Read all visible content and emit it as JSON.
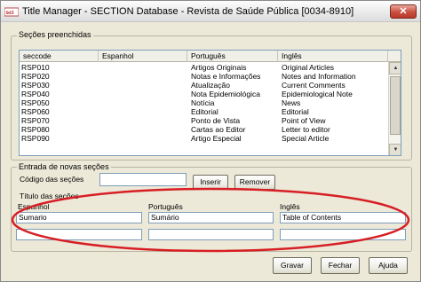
{
  "window": {
    "title": "Title Manager - SECTION Database - Revista de Saúde Pública [0034-8910]",
    "close_glyph": "✕"
  },
  "colors": {
    "annotation": "#d71e24",
    "window_bg": "#ece9d8",
    "list_border": "#7f9db9"
  },
  "sections_list": {
    "group_label": "Seções preenchidas",
    "columns": [
      "seccode",
      "Espanhol",
      "Português",
      "Inglês"
    ],
    "rows": [
      {
        "seccode": "RSP010",
        "espanhol": "",
        "portugues": "Artigos Originais",
        "ingles": "Original Articles"
      },
      {
        "seccode": "RSP020",
        "espanhol": "",
        "portugues": "Notas e Informações",
        "ingles": "Notes and Information"
      },
      {
        "seccode": "RSP030",
        "espanhol": "",
        "portugues": "Atualização",
        "ingles": "Current Comments"
      },
      {
        "seccode": "RSP040",
        "espanhol": "",
        "portugues": "Nota Epidemiológica",
        "ingles": "Epidemiological Note"
      },
      {
        "seccode": "RSP050",
        "espanhol": "",
        "portugues": "Notícia",
        "ingles": "News"
      },
      {
        "seccode": "RSP060",
        "espanhol": "",
        "portugues": "Editorial",
        "ingles": "Editorial"
      },
      {
        "seccode": "RSP070",
        "espanhol": "",
        "portugues": "Ponto de Vista",
        "ingles": "Point of View"
      },
      {
        "seccode": "RSP080",
        "espanhol": "",
        "portugues": "Cartas ao Editor",
        "ingles": "Letter to editor"
      },
      {
        "seccode": "RSP090",
        "espanhol": "",
        "portugues": "Artigo Especial",
        "ingles": "Special Article"
      }
    ]
  },
  "entry": {
    "group_label": "Entrada de novas seções",
    "code_label": "Código das seções",
    "code_value": "",
    "insert_button": "Inserir",
    "remove_button": "Remover",
    "titles_label": "Título das seções",
    "espanhol_label": "Espanhol",
    "portugues_label": "Português",
    "ingles_label": "Inglês",
    "espanhol_value": "Sumario",
    "portugues_value": "Sumário",
    "ingles_value": "Table of Contents",
    "espanhol_value2": "",
    "portugues_value2": "",
    "ingles_value2": ""
  },
  "footer": {
    "save_button": "Gravar",
    "close_button": "Fechar",
    "help_button": "Ajuda"
  }
}
